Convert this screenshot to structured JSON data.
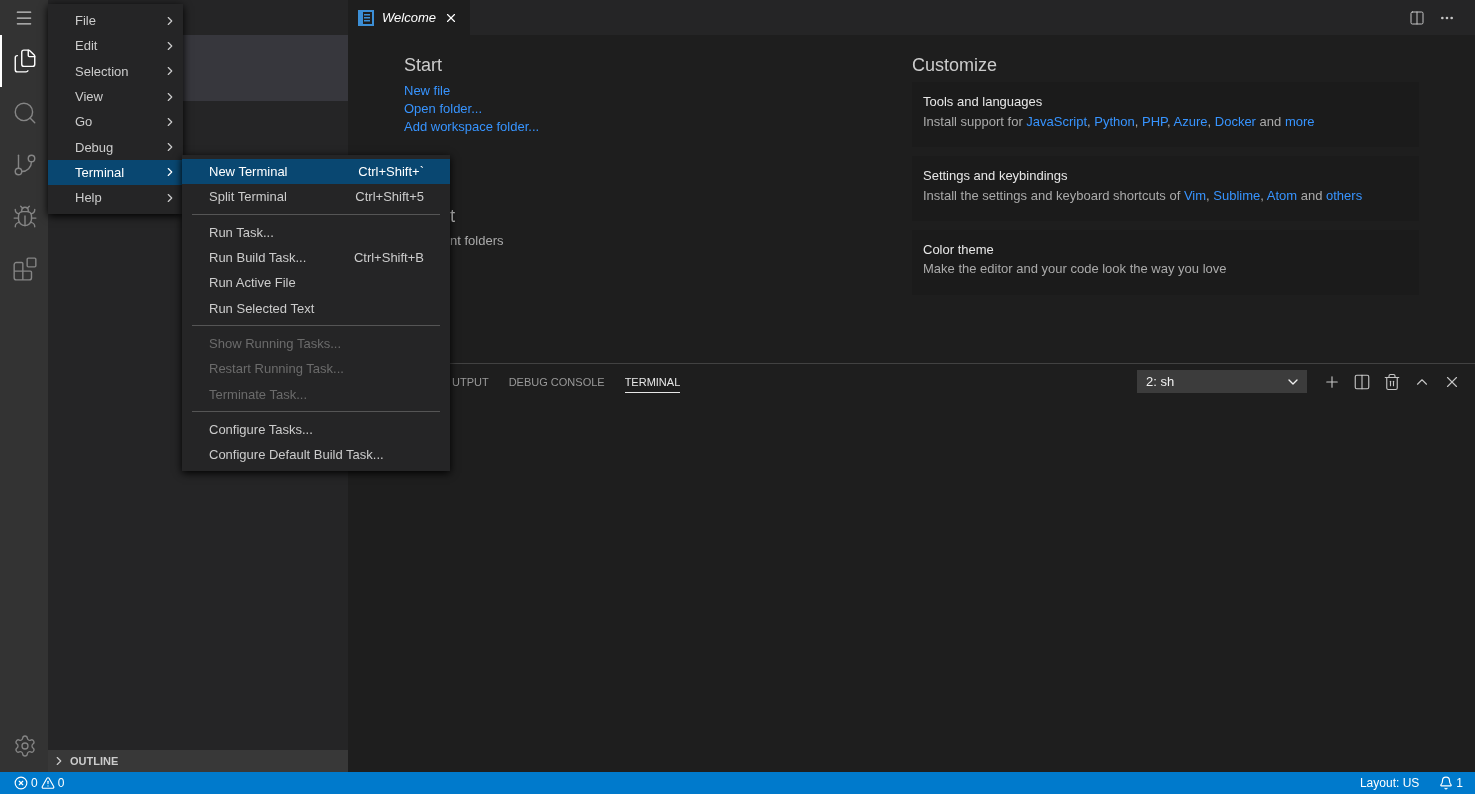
{
  "activity_bar": {
    "items": [
      {
        "selected": true
      },
      {
        "selected": false
      },
      {
        "selected": false
      },
      {
        "selected": false
      },
      {
        "selected": false
      }
    ]
  },
  "sidebar": {
    "outline": {
      "label": "OUTLINE",
      "expanded": false
    }
  },
  "editor": {
    "tabs": [
      {
        "title": "Welcome",
        "selected": true
      }
    ]
  },
  "welcome": {
    "start": {
      "title": "Start",
      "links": [
        "New file",
        "Open folder...",
        "Add workspace folder..."
      ]
    },
    "recent": {
      "title": "t",
      "text": "nt folders"
    },
    "customize": {
      "title": "Customize",
      "cards": [
        {
          "title": "Tools and languages",
          "description": [
            {
              "text": "Install support for "
            },
            {
              "text": "JavaScript",
              "link": true
            },
            {
              "text": ", "
            },
            {
              "text": "Python",
              "link": true
            },
            {
              "text": ", "
            },
            {
              "text": "PHP",
              "link": true
            },
            {
              "text": ", "
            },
            {
              "text": "Azure",
              "link": true
            },
            {
              "text": ", "
            },
            {
              "text": "Docker",
              "link": true
            },
            {
              "text": " and "
            },
            {
              "text": "more",
              "link": true
            }
          ]
        },
        {
          "title": "Settings and keybindings",
          "description": [
            {
              "text": "Install the settings and keyboard shortcuts of "
            },
            {
              "text": "Vim",
              "link": true
            },
            {
              "text": ", "
            },
            {
              "text": "Sublime",
              "link": true
            },
            {
              "text": ", "
            },
            {
              "text": "Atom",
              "link": true
            },
            {
              "text": " and "
            },
            {
              "text": "others",
              "link": true
            }
          ]
        },
        {
          "title": "Color theme",
          "description": [
            {
              "text": "Make the editor and your code look the way you love"
            }
          ]
        }
      ]
    }
  },
  "panel": {
    "tabs": [
      {
        "label": "UTPUT",
        "selected": false
      },
      {
        "label": "DEBUG CONSOLE",
        "selected": false
      },
      {
        "label": "TERMINAL",
        "selected": true
      }
    ],
    "terminal_select": {
      "value": "2: sh"
    }
  },
  "main_menu": {
    "items": [
      {
        "label": "File",
        "selected": false
      },
      {
        "label": "Edit",
        "selected": false
      },
      {
        "label": "Selection",
        "selected": false
      },
      {
        "label": "View",
        "selected": false
      },
      {
        "label": "Go",
        "selected": false
      },
      {
        "label": "Debug",
        "selected": false
      },
      {
        "label": "Terminal",
        "selected": true
      },
      {
        "label": "Help",
        "selected": false
      }
    ]
  },
  "submenu": {
    "items": [
      {
        "kind": "item",
        "label": "New Terminal",
        "shortcut": "Ctrl+Shift+`",
        "selected": true,
        "disabled": false
      },
      {
        "kind": "item",
        "label": "Split Terminal",
        "shortcut": "Ctrl+Shift+5",
        "selected": false,
        "disabled": false
      },
      {
        "kind": "separator"
      },
      {
        "kind": "item",
        "label": "Run Task...",
        "selected": false,
        "disabled": false
      },
      {
        "kind": "item",
        "label": "Run Build Task...",
        "shortcut": "Ctrl+Shift+B",
        "selected": false,
        "disabled": false
      },
      {
        "kind": "item",
        "label": "Run Active File",
        "selected": false,
        "disabled": false
      },
      {
        "kind": "item",
        "label": "Run Selected Text",
        "selected": false,
        "disabled": false
      },
      {
        "kind": "separator"
      },
      {
        "kind": "item",
        "label": "Show Running Tasks...",
        "selected": false,
        "disabled": true
      },
      {
        "kind": "item",
        "label": "Restart Running Task...",
        "selected": false,
        "disabled": true
      },
      {
        "kind": "item",
        "label": "Terminate Task...",
        "selected": false,
        "disabled": true
      },
      {
        "kind": "separator"
      },
      {
        "kind": "item",
        "label": "Configure Tasks...",
        "selected": false,
        "disabled": false
      },
      {
        "kind": "item",
        "label": "Configure Default Build Task...",
        "selected": false,
        "disabled": false
      }
    ]
  },
  "status_bar": {
    "errors": "0",
    "warnings": "0",
    "layout": "Layout: US",
    "notifications": "1"
  }
}
